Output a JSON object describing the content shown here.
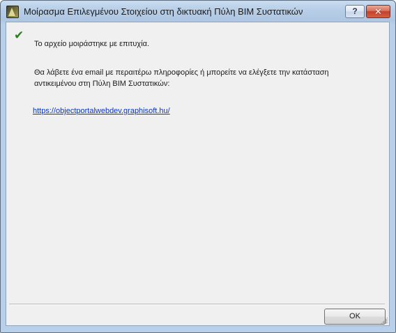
{
  "window": {
    "title": "Μοίρασμα Επιλεγμένου Στοιχείου στη δικτυακή Πύλη BIM Συστατικών",
    "help_label": "?",
    "close_label": "✕"
  },
  "content": {
    "success_message": "Το αρχείο μοιράστηκε με επιτυχία.",
    "info_message": "Θα λάβετε ένα email με περαιτέρω πληροφορίες ή μπορείτε να ελέγξετε την κατάσταση αντικειμένου στη Πύλη BIM Συστατικών:",
    "portal_link": "https://objectportalwebdev.graphisoft.hu/"
  },
  "footer": {
    "ok_label": "OK"
  },
  "icons": {
    "app": "archicad-app-icon",
    "status": "checkmark-icon",
    "help": "question-mark-icon",
    "close": "close-icon",
    "grip": "resize-grip-icon"
  },
  "colors": {
    "titlebar": "#b9cfe8",
    "client_bg": "#f0f0f0",
    "checkmark": "#2e7d23",
    "link": "#0b35c2",
    "close_button": "#c2412a"
  }
}
